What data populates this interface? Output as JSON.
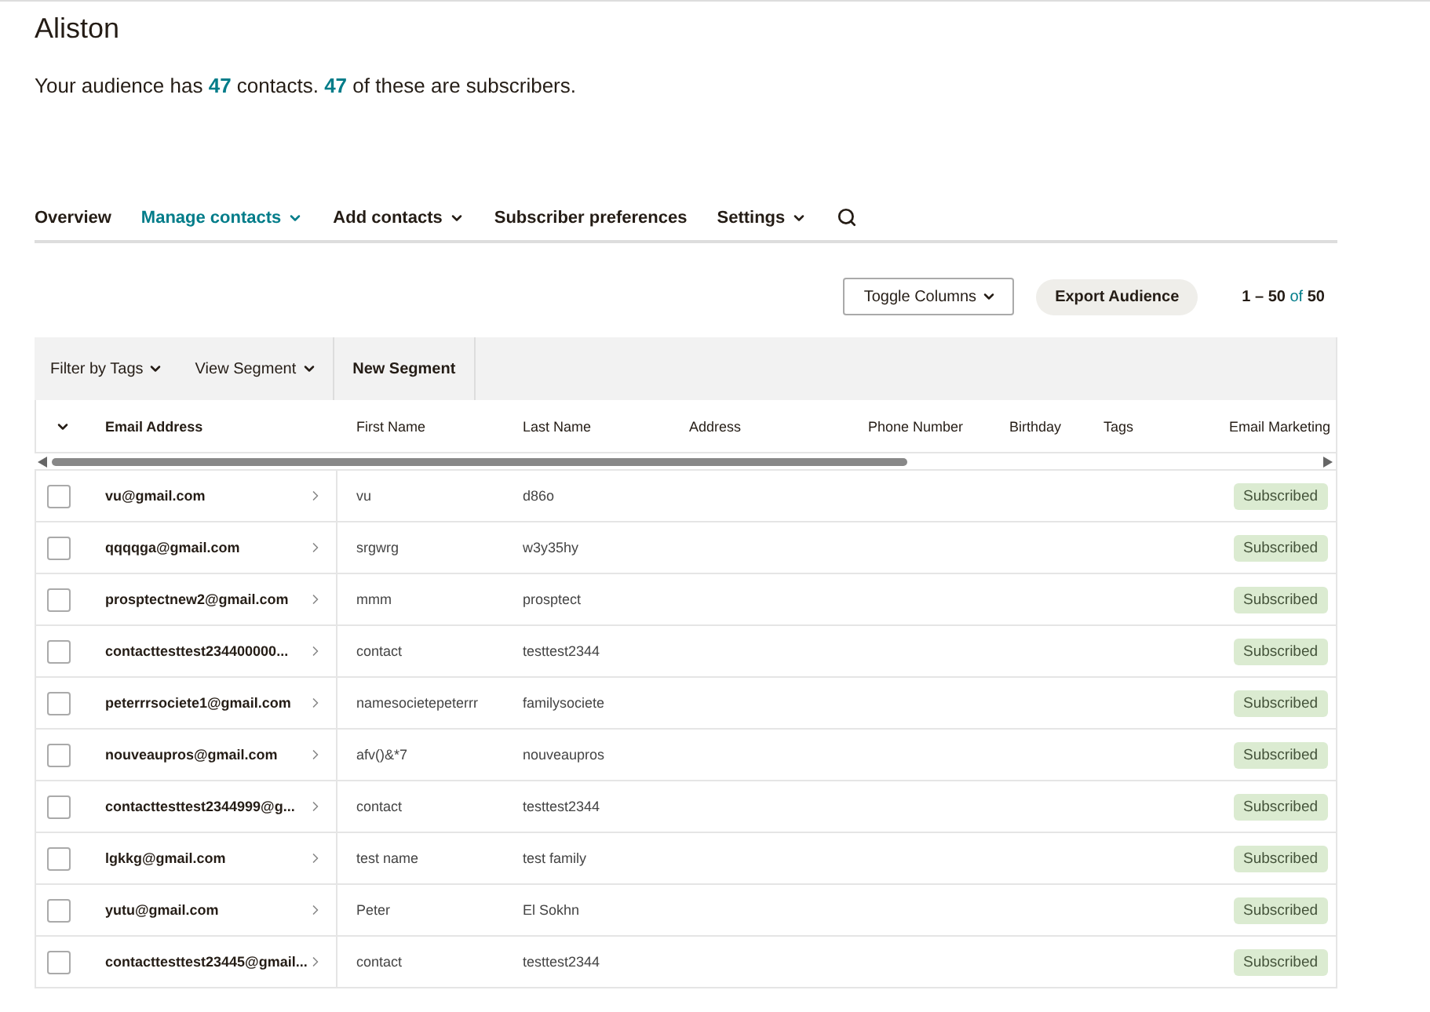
{
  "title": "Aliston",
  "summary": "Your audience has **47** contacts. **47** of these are subscribers.",
  "nav": [
    {
      "label": "Overview",
      "selected": false,
      "dropdown": false
    },
    {
      "label": "Manage contacts",
      "selected": true,
      "dropdown": true
    },
    {
      "label": "Add contacts",
      "selected": false,
      "dropdown": true
    },
    {
      "label": "Subscriber preferences",
      "selected": false,
      "dropdown": false
    },
    {
      "label": "Settings",
      "selected": false,
      "dropdown": true
    }
  ],
  "toolbar": {
    "toggle_columns": "Toggle Columns",
    "export": "Export Audience",
    "range": "1 – 50",
    "of": "of",
    "total": "50"
  },
  "filters": [
    {
      "label": "Filter by Tags",
      "kind": "menu"
    },
    {
      "label": "View Segment",
      "kind": "menu"
    },
    {
      "label": "New Segment",
      "kind": "action"
    }
  ],
  "table": {
    "columns": [
      "Email Address",
      "First Name",
      "Last Name",
      "Address",
      "Phone Number",
      "Birthday",
      "Tags",
      "Email Marketing"
    ],
    "rows": [
      {
        "checked": false,
        "email": "vu@gmail.com",
        "first": "vu",
        "last": "d86o",
        "status": "Subscribed"
      },
      {
        "checked": false,
        "email": "qqqqga@gmail.com",
        "first": "srgwrg",
        "last": "w3y35hy",
        "status": "Subscribed"
      },
      {
        "checked": false,
        "email": "prosptectnew2@gmail.com",
        "first": "mmm",
        "last": "prosptect",
        "status": "Subscribed"
      },
      {
        "checked": false,
        "email": "contacttesttest234400000...",
        "first": "contact",
        "last": "testtest2344",
        "status": "Subscribed"
      },
      {
        "checked": false,
        "email": "peterrrsociete1@gmail.com",
        "first": "namesocietepeterrr",
        "last": "familysociete",
        "status": "Subscribed"
      },
      {
        "checked": false,
        "email": "nouveaupros@gmail.com",
        "first": "afv()&*7",
        "last": "nouveaupros",
        "status": "Subscribed"
      },
      {
        "checked": false,
        "email": "contacttesttest2344999@g...",
        "first": "contact",
        "last": "testtest2344",
        "status": "Subscribed"
      },
      {
        "checked": false,
        "email": "lgkkg@gmail.com",
        "first": "test name",
        "last": "test family",
        "status": "Subscribed"
      },
      {
        "checked": false,
        "email": "yutu@gmail.com",
        "first": "Peter",
        "last": "El Sokhn",
        "status": "Subscribed"
      },
      {
        "checked": false,
        "email": "contacttesttest23445@gmail...",
        "first": "contact",
        "last": "testtest2344",
        "status": "Subscribed"
      }
    ]
  }
}
